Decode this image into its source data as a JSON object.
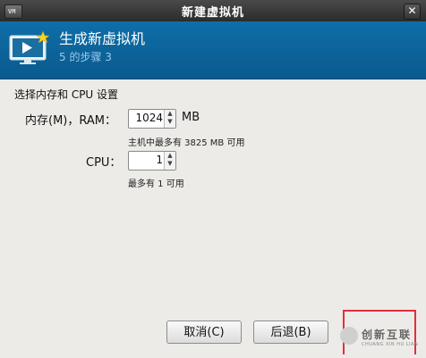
{
  "window": {
    "title": "新建虚拟机",
    "menu_glyph": "VM",
    "close_glyph": "✕"
  },
  "header": {
    "title": "生成新虚拟机",
    "subtitle": "5 的步骤 3",
    "icon": "monitor-play-icon"
  },
  "form": {
    "section_label": "选择内存和 CPU 设置",
    "ram": {
      "label": "内存(M)，RAM：",
      "value": "1024",
      "unit": "MB",
      "hint": "主机中最多有 3825 MB 可用"
    },
    "cpu": {
      "label": "CPU：",
      "value": "1",
      "hint": "最多有 1 可用"
    }
  },
  "buttons": {
    "cancel": "取消(C)",
    "back": "后退(B)"
  },
  "watermark": {
    "text": "创新互联",
    "subtext": "CHUANG XIN HU LIAN"
  },
  "colors": {
    "header_bg": "#0f6ea8",
    "highlight": "#e0303a"
  }
}
